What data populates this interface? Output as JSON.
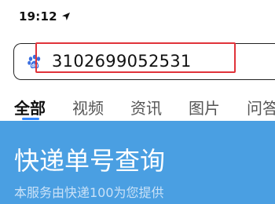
{
  "status_bar": {
    "time": "19:12",
    "location_icon": "location-arrow-icon"
  },
  "search": {
    "query": "3102699052531",
    "engine_icon": "baidu-paw-icon",
    "highlight_color": "#e0333a"
  },
  "tabs": [
    {
      "label": "全部",
      "active": true
    },
    {
      "label": "视频",
      "active": false
    },
    {
      "label": "资讯",
      "active": false
    },
    {
      "label": "图片",
      "active": false
    },
    {
      "label": "问答",
      "active": false
    }
  ],
  "result_card": {
    "title": "快递单号查询",
    "subtitle": "本服务由快递100为您提供",
    "background_color": "#4a9fe2"
  },
  "colors": {
    "accent": "#3388ff",
    "paw": "#3b6fe0"
  }
}
